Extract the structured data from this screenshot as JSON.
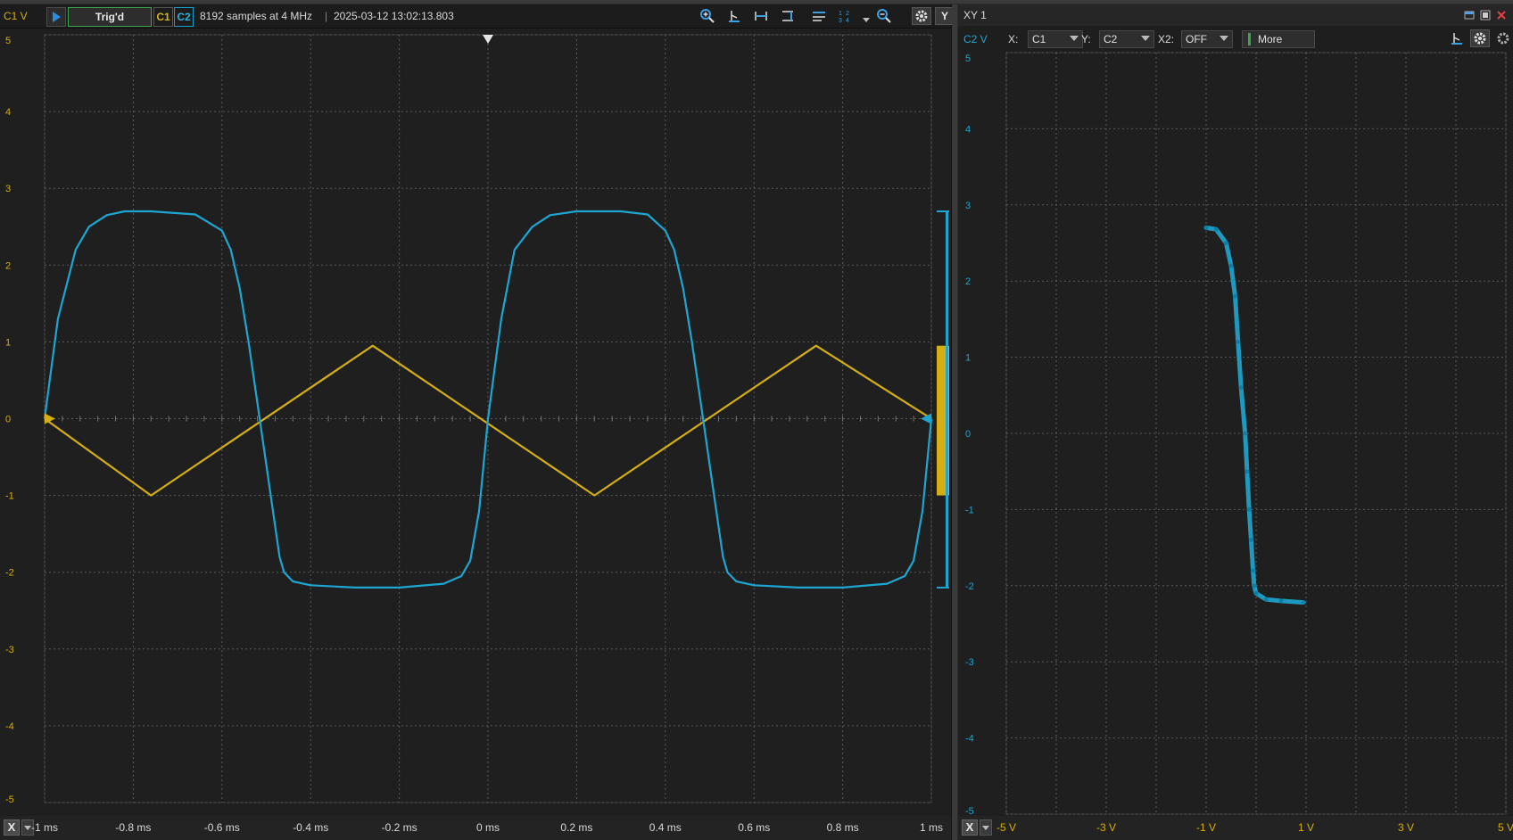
{
  "colors": {
    "c1": "#d4ae14",
    "c2": "#1ea6d2",
    "grid": "#5a5a5a",
    "trig_border": "#3aa84a"
  },
  "scope": {
    "y_axis_label": "C1 V",
    "trig_status": "Trig'd",
    "ch1_label": "C1",
    "ch2_label": "C2",
    "acq_info": "8192 samples at 4 MHz",
    "timestamp": "2025-03-12 13:02:13.803",
    "y_button": "Y",
    "x_button": "X",
    "toolbar_icons": [
      "zoom-in-icon",
      "cursor-icon",
      "horizontal-cursor-icon",
      "vertical-cursor-icon",
      "bars-icon",
      "measurements-icon",
      "dropdown-icon",
      "zoom-out-icon",
      "gear-icon"
    ]
  },
  "xy": {
    "title": "XY 1",
    "y_axis_label": "C2 V",
    "x_label": "X:",
    "x_value": "C1",
    "y_label": "Y:",
    "y_value": "C2",
    "x2_label": "X2:",
    "x2_value": "OFF",
    "more_label": "More",
    "x_button": "X"
  },
  "chart_data": [
    {
      "type": "line",
      "title": "",
      "xlabel": "",
      "ylabel": "C1 V",
      "xlim": [
        -1,
        1
      ],
      "ylim": [
        -5,
        5
      ],
      "x_unit": "ms",
      "x_ticks": [
        "-1 ms",
        "-0.8 ms",
        "-0.6 ms",
        "-0.4 ms",
        "-0.2 ms",
        "0 ms",
        "0.2 ms",
        "0.4 ms",
        "0.6 ms",
        "0.8 ms",
        "1 ms"
      ],
      "y_ticks": [
        "5",
        "4",
        "3",
        "2",
        "1",
        "0",
        "-1",
        "-2",
        "-3",
        "-4",
        "-5"
      ],
      "grid": true,
      "series": [
        {
          "name": "C1",
          "x": [
            -1.0,
            -0.76,
            -0.26,
            0.24,
            0.74,
            1.0
          ],
          "values": [
            0.0,
            -1.0,
            0.95,
            -1.0,
            0.95,
            0.0
          ]
        },
        {
          "name": "C2",
          "x": [
            -1.0,
            -0.97,
            -0.93,
            -0.9,
            -0.86,
            -0.82,
            -0.76,
            -0.66,
            -0.6,
            -0.58,
            -0.56,
            -0.54,
            -0.52,
            -0.5,
            -0.48,
            -0.47,
            -0.46,
            -0.44,
            -0.4,
            -0.3,
            -0.2,
            -0.1,
            -0.06,
            -0.04,
            -0.02,
            0.0,
            0.03,
            0.06,
            0.1,
            0.14,
            0.2,
            0.3,
            0.36,
            0.4,
            0.42,
            0.44,
            0.46,
            0.48,
            0.5,
            0.52,
            0.53,
            0.54,
            0.56,
            0.6,
            0.7,
            0.8,
            0.9,
            0.94,
            0.96,
            0.98,
            1.0
          ],
          "values": [
            0.0,
            1.3,
            2.2,
            2.5,
            2.65,
            2.7,
            2.7,
            2.66,
            2.45,
            2.2,
            1.7,
            1.0,
            0.2,
            -0.6,
            -1.4,
            -1.8,
            -2.0,
            -2.12,
            -2.17,
            -2.2,
            -2.2,
            -2.15,
            -2.05,
            -1.85,
            -1.2,
            0.0,
            1.3,
            2.2,
            2.5,
            2.65,
            2.7,
            2.7,
            2.66,
            2.45,
            2.2,
            1.7,
            1.0,
            0.2,
            -0.6,
            -1.4,
            -1.8,
            -2.0,
            -2.12,
            -2.17,
            -2.2,
            -2.2,
            -2.15,
            -2.05,
            -1.85,
            -1.2,
            0.0
          ]
        }
      ]
    },
    {
      "type": "scatter",
      "title": "",
      "xlabel": "",
      "ylabel": "C2 V",
      "xlim": [
        -5,
        5
      ],
      "ylim": [
        -5,
        5
      ],
      "x_ticks": [
        "-5 V",
        "-3 V",
        "-1 V",
        "1 V",
        "3 V",
        "5 V"
      ],
      "y_ticks": [
        "5",
        "4",
        "3",
        "2",
        "1",
        "0",
        "-1",
        "-2",
        "-3",
        "-4",
        "-5"
      ],
      "grid": true,
      "series": [
        {
          "name": "C2",
          "x": [
            -1.0,
            -0.8,
            -0.6,
            -0.5,
            -0.42,
            -0.36,
            -0.3,
            -0.22,
            -0.18,
            -0.14,
            -0.1,
            -0.06,
            -0.04,
            0.0,
            0.2,
            0.5,
            0.95
          ],
          "values": [
            2.7,
            2.68,
            2.5,
            2.2,
            1.8,
            1.2,
            0.6,
            0.0,
            -0.5,
            -1.0,
            -1.4,
            -1.8,
            -2.0,
            -2.1,
            -2.18,
            -2.2,
            -2.22
          ]
        }
      ]
    }
  ]
}
